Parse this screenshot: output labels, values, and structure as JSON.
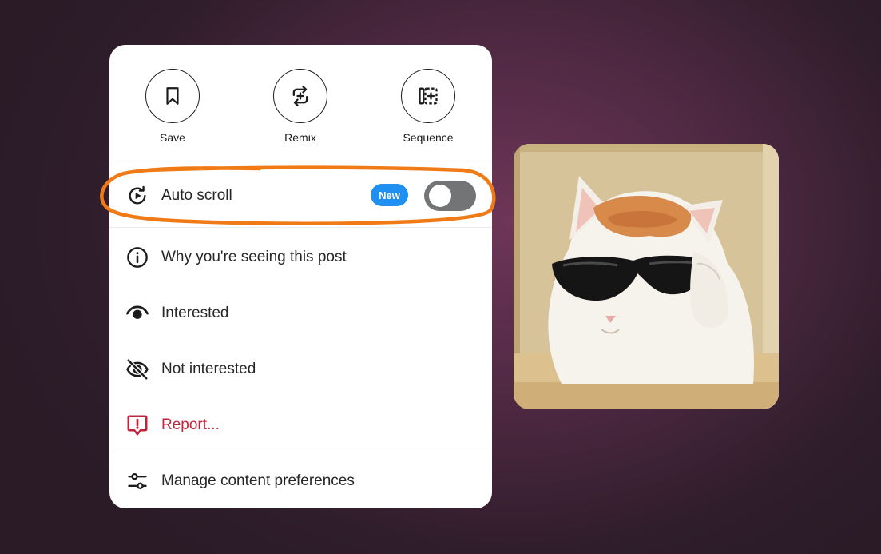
{
  "menu": {
    "actions": [
      {
        "label": "Save",
        "icon": "bookmark-icon"
      },
      {
        "label": "Remix",
        "icon": "remix-icon"
      },
      {
        "label": "Sequence",
        "icon": "sequence-icon"
      }
    ],
    "auto_scroll": {
      "label": "Auto scroll",
      "icon": "auto-scroll-icon",
      "badge": "New",
      "toggle_on": false
    },
    "items": [
      {
        "label": "Why you're seeing this post",
        "icon": "info-icon"
      },
      {
        "label": "Interested",
        "icon": "eye-icon"
      },
      {
        "label": "Not interested",
        "icon": "eye-crossed-icon"
      },
      {
        "label": "Report...",
        "icon": "report-icon",
        "color": "#c4233c"
      },
      {
        "label": "Manage content preferences",
        "icon": "sliders-icon"
      }
    ]
  },
  "colors": {
    "highlight": "#f07a16",
    "badge": "#1f8ff0",
    "toggle_off": "#737476",
    "report": "#c4233c"
  },
  "image": {
    "subject": "cat wearing sunglasses"
  }
}
